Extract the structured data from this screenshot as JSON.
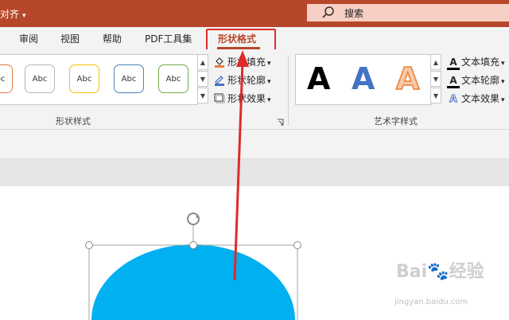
{
  "titlebar": {
    "left_text": "对齐",
    "search_label": "搜索",
    "bg_color": "#b7472a"
  },
  "tabs": [
    {
      "label": "审阅"
    },
    {
      "label": "视图"
    },
    {
      "label": "帮助"
    },
    {
      "label": "PDF工具集"
    },
    {
      "label": "形状格式",
      "active": true
    }
  ],
  "shape_styles": {
    "group_label": "形状样式",
    "gallery": [
      {
        "label": "Abc",
        "border": "#e07b39"
      },
      {
        "label": "Abc",
        "border": "#b5b5b5"
      },
      {
        "label": "Abc",
        "border": "#f2c200"
      },
      {
        "label": "Abc",
        "border": "#4f81bd"
      },
      {
        "label": "Abc",
        "border": "#70ad47"
      }
    ],
    "commands": [
      {
        "label": "形状填充",
        "icon": "paint-bucket-icon"
      },
      {
        "label": "形状轮廓",
        "icon": "pen-outline-icon"
      },
      {
        "label": "形状效果",
        "icon": "shape-effects-icon"
      }
    ]
  },
  "art_styles": {
    "group_label": "艺术字样式",
    "gallery": [
      {
        "letter": "A",
        "color": "#000000"
      },
      {
        "letter": "A",
        "color": "#4472c4"
      },
      {
        "letter": "A",
        "color": "#ed7d31"
      }
    ],
    "commands": [
      {
        "label": "文本填充",
        "icon": "text-fill-icon"
      },
      {
        "label": "文本轮廓",
        "icon": "text-outline-icon"
      },
      {
        "label": "文本效果",
        "icon": "text-effects-icon"
      }
    ]
  },
  "canvas": {
    "shape_color": "#00b0f0",
    "highlight_color": "#e02a2a"
  },
  "watermark": {
    "brand": "Bai",
    "brand2": "经验",
    "url": "jingyan.baidu.com"
  }
}
